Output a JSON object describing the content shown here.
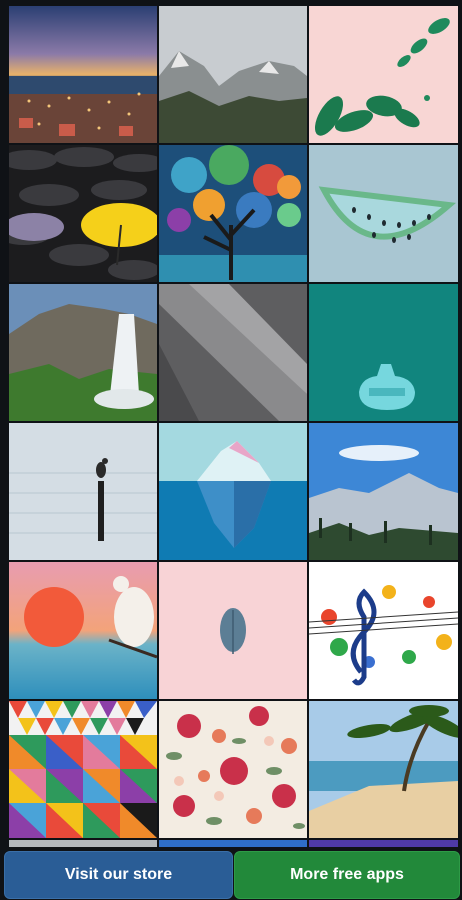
{
  "wallpapers": [
    {
      "name": "city-at-dusk-icon"
    },
    {
      "name": "mountain-valley-icon"
    },
    {
      "name": "tropical-leaves-icon"
    },
    {
      "name": "umbrellas-icon"
    },
    {
      "name": "painted-tree-icon"
    },
    {
      "name": "watermelon-slice-icon"
    },
    {
      "name": "waterfall-icon"
    },
    {
      "name": "grey-material-icon"
    },
    {
      "name": "teal-bag-icon"
    },
    {
      "name": "heron-on-post-icon"
    },
    {
      "name": "iceberg-icon"
    },
    {
      "name": "snowy-mountains-icon"
    },
    {
      "name": "dove-sunset-icon"
    },
    {
      "name": "leaf-on-pink-icon"
    },
    {
      "name": "music-notes-icon"
    },
    {
      "name": "colorful-triangles-icon"
    },
    {
      "name": "floral-pattern-icon"
    },
    {
      "name": "palm-beach-icon"
    }
  ],
  "actions": {
    "store_label": "Visit our store",
    "apps_label": "More free apps",
    "store_color": "#2a5d96",
    "apps_color": "#22893a"
  }
}
